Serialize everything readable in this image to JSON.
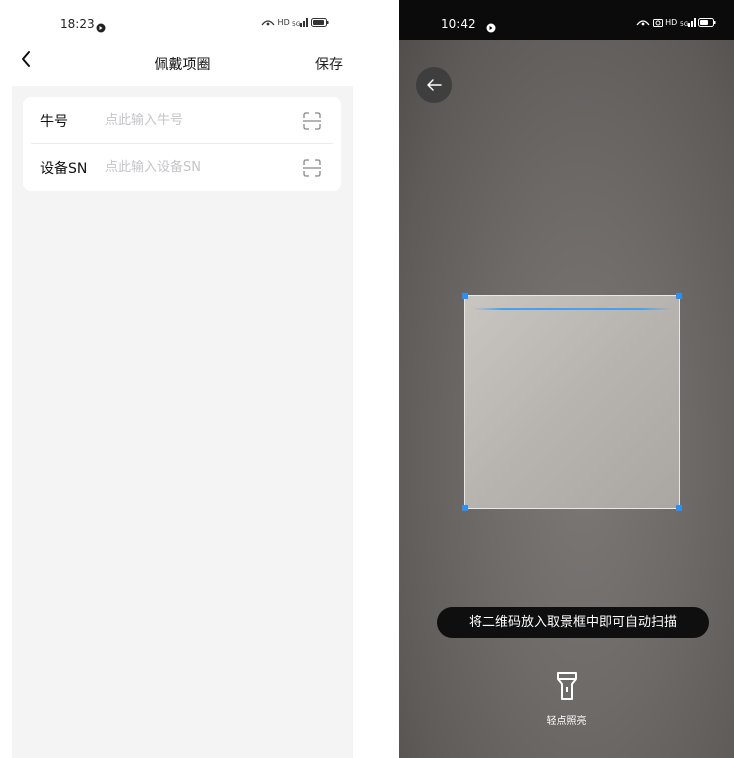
{
  "left_screen": {
    "status_bar": {
      "time": "18:23",
      "indicators": "HD"
    },
    "nav": {
      "back_icon": "chevron-left-icon",
      "title": "佩戴项圈",
      "save_label": "保存"
    },
    "form": {
      "rows": [
        {
          "label": "牛号",
          "value": "",
          "placeholder": "点此输入牛号",
          "action_icon": "scan-icon"
        },
        {
          "label": "设备SN",
          "value": "",
          "placeholder": "点此输入设备SN",
          "action_icon": "scan-icon"
        }
      ]
    }
  },
  "right_screen": {
    "status_bar": {
      "time": "10:42",
      "indicators": "HD"
    },
    "back_icon": "arrow-left-icon",
    "scanner": {
      "frame_corner_color": "#2f8ff0",
      "scan_line_color": "#4aa0f0"
    },
    "hint": "将二维码放入取景框中即可自动扫描",
    "torch": {
      "icon": "flashlight-icon",
      "label": "轻点照亮"
    }
  }
}
